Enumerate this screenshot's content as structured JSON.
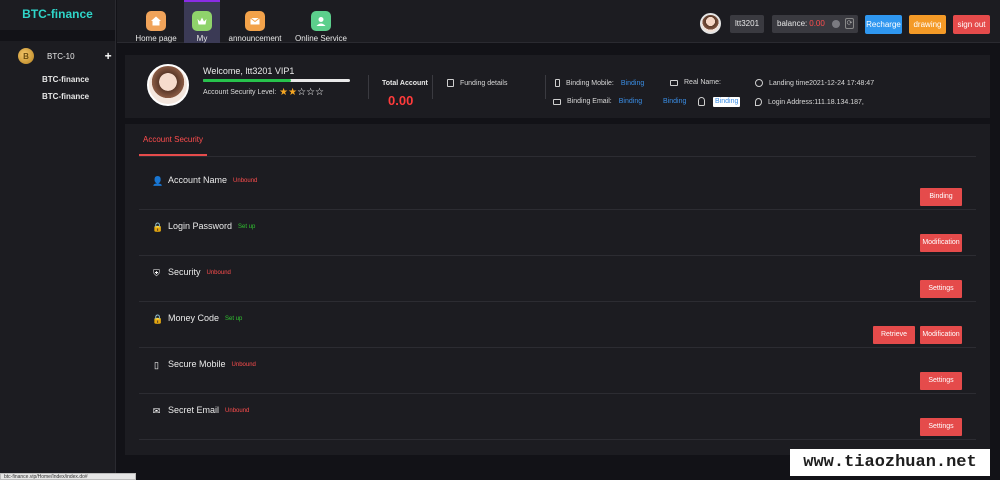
{
  "brand": "BTC-finance",
  "sidebar": {
    "coin": {
      "symbol": "B",
      "label": "BTC-10",
      "expand": "+"
    },
    "items": [
      {
        "label": "BTC-finance"
      },
      {
        "label": "BTC-finance"
      }
    ]
  },
  "nav": [
    {
      "label": "Home page",
      "icon": "home-icon",
      "color": "#f0a35a"
    },
    {
      "label": "My",
      "icon": "crown-icon",
      "color": "#8fd36b",
      "active": true
    },
    {
      "label": "announcement",
      "icon": "mail-icon",
      "color": "#f2a24a"
    },
    {
      "label": "Online Service",
      "icon": "service-icon",
      "color": "#5ccf8c"
    }
  ],
  "header": {
    "username": "ltt3201",
    "balance_label": "balance:",
    "balance_value": "0.00",
    "refresh_glyph": "⟳",
    "recharge": "Recharge",
    "drawing": "drawing",
    "signout": "sign out"
  },
  "profile": {
    "welcome": "Welcome, ltt3201 VIP1",
    "security_label": "Account Security Level:",
    "security_level": 0.6,
    "stars": [
      "★",
      "★",
      "☆",
      "☆",
      "☆"
    ],
    "total_label": "Total Account",
    "total_value": "0.00",
    "funding": "Funding details",
    "mobile_label": "Binding Mobile:",
    "mobile_link": "Binding",
    "email_label": "Binding Email:",
    "email_link": "Binding",
    "realname_label": "Real Name:",
    "realname_link": "Binding",
    "qq_link": "Binding",
    "landing": "Landing time2021-12-24 17:48:47",
    "login_addr": "Login Address:111.18.134.187,"
  },
  "security": {
    "tab": "Account Security",
    "rows": [
      {
        "title": "Account Name",
        "status": "Unbound",
        "state": "red",
        "icon": "user-icon",
        "glyph": "👤",
        "buttons": [
          "Binding"
        ]
      },
      {
        "title": "Login Password",
        "status": "Set up",
        "state": "green",
        "icon": "lock-icon",
        "glyph": "🔒",
        "buttons": [
          "Modification"
        ]
      },
      {
        "title": "Security",
        "status": "Unbound",
        "state": "red",
        "icon": "shield-icon",
        "glyph": "⛨",
        "buttons": [
          "Settings"
        ]
      },
      {
        "title": "Money Code",
        "status": "Set up",
        "state": "green",
        "icon": "lock-icon",
        "glyph": "🔒",
        "buttons": [
          "Retrieve",
          "Modification"
        ]
      },
      {
        "title": "Secure Mobile",
        "status": "Unbound",
        "state": "red",
        "icon": "mobile-icon",
        "glyph": "▯",
        "buttons": [
          "Settings"
        ]
      },
      {
        "title": "Secret Email",
        "status": "Unbound",
        "state": "red",
        "icon": "email-icon",
        "glyph": "✉",
        "buttons": [
          "Settings"
        ]
      }
    ]
  },
  "statusbar": "btc-finance.vip/Home/Index/index.do#",
  "watermark": "www.tiaozhuan.net"
}
